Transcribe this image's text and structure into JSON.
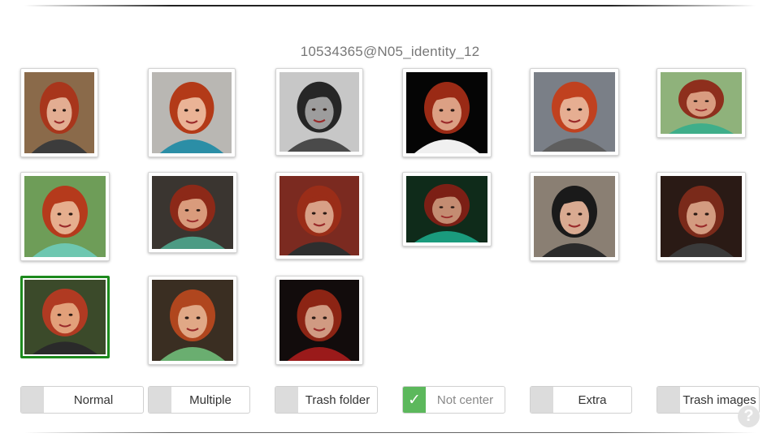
{
  "page": {
    "title": "10534365@N05_identity_12"
  },
  "images": [
    {
      "name": "thumb-1",
      "selected": false,
      "bg": "#8a6a4a",
      "skin": "#e3ad92",
      "hair": "#a8361c",
      "top": "#3c3c3c"
    },
    {
      "name": "thumb-2",
      "selected": false,
      "bg": "#b9b7b3",
      "skin": "#eab396",
      "hair": "#b33a18",
      "top": "#2b8ea6"
    },
    {
      "name": "thumb-3",
      "selected": false,
      "bg": "#c7c7c7",
      "skin": "#9d9d9d",
      "hair": "#262626",
      "top": "#4a4a4a"
    },
    {
      "name": "thumb-4",
      "selected": false,
      "bg": "#050505",
      "skin": "#dca084",
      "hair": "#9a2a15",
      "top": "#f0f0f0"
    },
    {
      "name": "thumb-5",
      "selected": false,
      "bg": "#7a7f87",
      "skin": "#e6ae92",
      "hair": "#c0411f",
      "top": "#5e5e5e"
    },
    {
      "name": "thumb-6",
      "selected": false,
      "bg": "#8fb27b",
      "skin": "#d99c80",
      "hair": "#8e2f1d",
      "top": "#3fae8a"
    },
    {
      "name": "thumb-7",
      "selected": false,
      "bg": "#6e9d58",
      "skin": "#e6ae8e",
      "hair": "#b53a1c",
      "top": "#6ec7b0"
    },
    {
      "name": "thumb-8",
      "selected": false,
      "bg": "#3a3530",
      "skin": "#d99b7c",
      "hair": "#8c2918",
      "top": "#4c9b84"
    },
    {
      "name": "thumb-9",
      "selected": false,
      "bg": "#7b2a20",
      "skin": "#d8a087",
      "hair": "#9a2d18",
      "top": "#2e2e2e"
    },
    {
      "name": "thumb-10",
      "selected": false,
      "bg": "#0f2b1a",
      "skin": "#c48c72",
      "hair": "#7c1f15",
      "top": "#1a9b7d"
    },
    {
      "name": "thumb-11",
      "selected": false,
      "bg": "#8a7f73",
      "skin": "#d9aa91",
      "hair": "#1a1a1a",
      "top": "#2a2a2a"
    },
    {
      "name": "thumb-12",
      "selected": false,
      "bg": "#2a1a15",
      "skin": "#d39b80",
      "hair": "#7a2a1a",
      "top": "#3a3a3a"
    },
    {
      "name": "thumb-13",
      "selected": true,
      "bg": "#3b4a2a",
      "skin": "#e2a07a",
      "hair": "#b03a22",
      "top": "#2a2a2a"
    },
    {
      "name": "thumb-14",
      "selected": false,
      "bg": "#3a2e22",
      "skin": "#e0a886",
      "hair": "#b0461e",
      "top": "#6aae70"
    },
    {
      "name": "thumb-15",
      "selected": false,
      "bg": "#120c0c",
      "skin": "#d09a82",
      "hair": "#8c2414",
      "top": "#9a1a1a"
    }
  ],
  "buttons": [
    {
      "name": "normal-button",
      "label": "Normal",
      "checked": false
    },
    {
      "name": "multiple-button",
      "label": "Multiple",
      "checked": false
    },
    {
      "name": "trash-folder-button",
      "label": "Trash folder",
      "checked": false
    },
    {
      "name": "not-center-button",
      "label": "Not center",
      "checked": true
    },
    {
      "name": "extra-button",
      "label": "Extra",
      "checked": false
    },
    {
      "name": "trash-images-button",
      "label": "Trash images",
      "checked": false
    }
  ],
  "check_mark": "✓",
  "help": {
    "icon": "question-circle-icon",
    "glyph": "?"
  },
  "colors": {
    "selected_border": "#1d8a1d",
    "checked_accent": "#5cb85c",
    "unchecked_box": "#dcdcdc"
  }
}
